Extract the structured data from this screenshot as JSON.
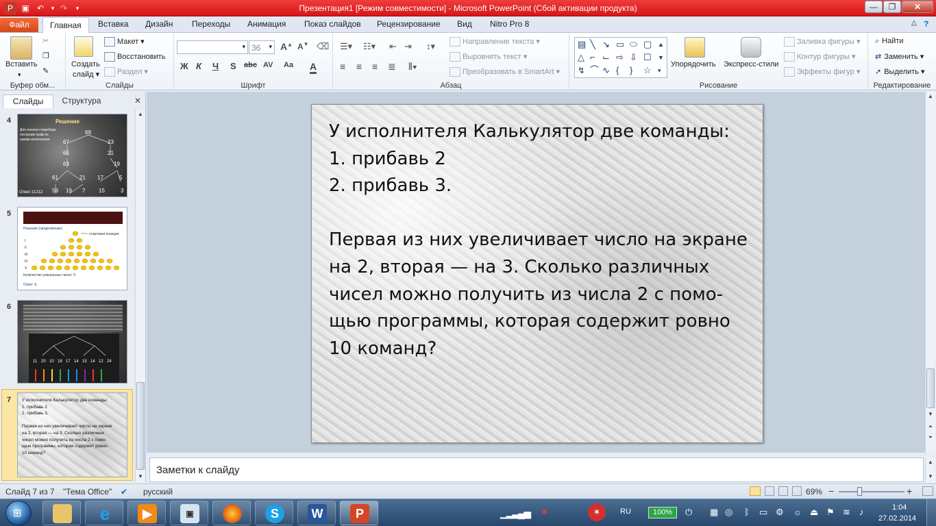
{
  "window": {
    "title": "Презентация1 [Режим совместимости]  -  Microsoft PowerPoint (Сбой активации продукта)",
    "minimize": "—",
    "restore": "❐",
    "close": "✕"
  },
  "ribbon_tabs": [
    "Файл",
    "Главная",
    "Вставка",
    "Дизайн",
    "Переходы",
    "Анимация",
    "Показ слайдов",
    "Рецензирование",
    "Вид",
    "Nitro Pro 8"
  ],
  "ribbon": {
    "clipboard": {
      "paste": "Вставить",
      "label": "Буфер обм..."
    },
    "slides": {
      "new_slide_l1": "Создать",
      "new_slide_l2": "слайд ▾",
      "layout": "Макет ▾",
      "reset": "Восстановить",
      "section": "Раздел ▾",
      "label": "Слайды"
    },
    "font": {
      "font_size": "36",
      "bold": "Ж",
      "italic": "К",
      "underline": "Ч",
      "shadow": "S",
      "strike": "abc",
      "spacing": "AV",
      "case": "Aa",
      "color": "A",
      "label": "Шрифт"
    },
    "paragraph": {
      "text_direction": "Направление текста ▾",
      "align_text": "Выровнять текст ▾",
      "smartart": "Преобразовать в SmartArt ▾",
      "label": "Абзац"
    },
    "drawing": {
      "arrange": "Упорядочить",
      "quick_styles": "Экспресс-стили",
      "fill": "Заливка фигуры ▾",
      "outline": "Контур фигуры ▾",
      "effects": "Эффекты фигур ▾",
      "label": "Рисование"
    },
    "editing": {
      "find": "Найти",
      "replace": "Заменить ▾",
      "select": "Выделить ▾",
      "label": "Редактирование"
    }
  },
  "panel": {
    "tab_slides": "Слайды",
    "tab_outline": "Структура",
    "close": "✕"
  },
  "thumbnails": [
    {
      "num": "4",
      "title": "Решение",
      "text": "Для полного перебора построим граф по шагам исполнения",
      "answer": "Ответ:11212",
      "nodes": [
        "69",
        "67",
        "23",
        "65",
        "21",
        "63",
        "19",
        "61",
        "21",
        "17",
        "5",
        "59",
        "19",
        "7",
        "15",
        "3"
      ]
    },
    {
      "num": "5",
      "caption": "Решение (продолжение)",
      "legend": "стартовая позиция",
      "rows": [
        "I",
        "II",
        "III",
        "IV",
        "V"
      ],
      "footer": "Количество уникальных чисел: 6",
      "answer": "Ответ: 6."
    },
    {
      "num": "6",
      "numbers": [
        "11",
        "20",
        "10",
        "18",
        "17",
        "14",
        "15",
        "14",
        "12",
        "24"
      ]
    },
    {
      "num": "7",
      "lines": [
        "У исполнителя  Калькулятор две команды:",
        "1. прибавь 2",
        "2. прибавь 3.",
        "",
        "Первая из них увеличивает число на экране",
        "на 2, вторая — на 3. Сколько различных",
        "чисел можно  получить из числа 2 с помо-",
        "щью программы,  которая содержит ровно",
        "10 команд?"
      ]
    }
  ],
  "slide": {
    "line1": "У исполнителя Калькулятор две команды:",
    "line2": "1. прибавь 2",
    "line3": "2. прибавь 3.",
    "line4": "Первая из них увеличивает число на экране",
    "line5": "на 2, вторая — на 3. Сколько различных",
    "line6": "чисел можно получить из числа 2 с помо-",
    "line7": "щью программы, которая содержит ровно",
    "line8": "10 команд?"
  },
  "notes_placeholder": "Заметки к слайду",
  "status": {
    "slide_of": "Слайд 7 из 7",
    "theme": "\"Тема Office\"",
    "language": "русский",
    "zoom": "69%",
    "zoom_minus": "−",
    "zoom_plus": "+"
  },
  "taskbar": {
    "lang": "RU",
    "battery": "100%",
    "time": "1:04",
    "date": "27.02.2014"
  },
  "colors": {
    "accent": "#e02020",
    "file_tab": "#e2572a",
    "taskbar": "#2e5077"
  }
}
